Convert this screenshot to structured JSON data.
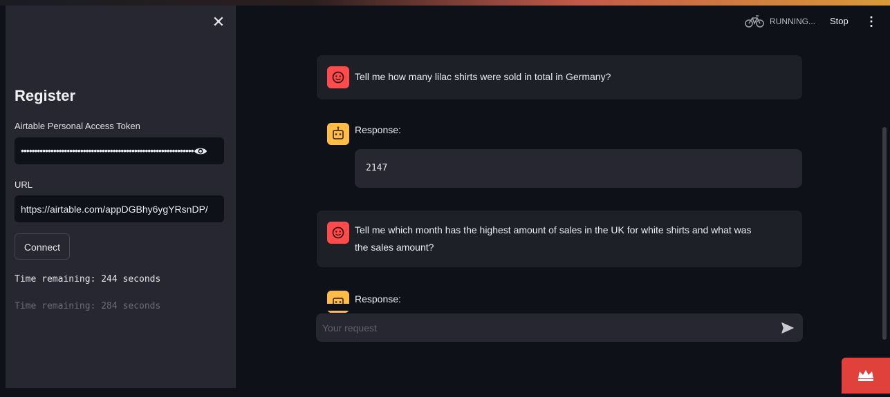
{
  "sidebar": {
    "close_label": "✕",
    "title": "Register",
    "token_label": "Airtable Personal Access Token",
    "token_masked": "••••••••••••••••••••••••••••••••••••••••••••••••••••••••••••••••",
    "url_label": "URL",
    "url_value": "https://airtable.com/appDGBhy6ygYRsnDP/",
    "connect_label": "Connect",
    "timer_current": "Time remaining: 244 seconds",
    "timer_previous": "Time remaining: 284 seconds"
  },
  "toolbar": {
    "status": "RUNNING...",
    "stop_label": "Stop",
    "menu_label": "⋮"
  },
  "chat": {
    "messages": [
      {
        "role": "user",
        "text": "Tell me how many lilac shirts were sold in total in Germany?"
      },
      {
        "role": "assistant",
        "label": "Response:",
        "value": "2147"
      },
      {
        "role": "user",
        "text_line1": "Tell me which month has the highest amount of sales in the UK for white shirts and what was",
        "text_line2": "the sales amount?"
      },
      {
        "role": "assistant",
        "label": "Response:"
      }
    ],
    "input_placeholder": "Your request"
  },
  "colors": {
    "user_avatar": "#ff4b4b",
    "assistant_avatar": "#ffbd45",
    "accent_red": "#e0413a"
  },
  "icons": [
    "close-icon",
    "eye-icon",
    "bicycle-icon",
    "kebab-menu-icon",
    "user-avatar-icon",
    "bot-avatar-icon",
    "send-icon",
    "crown-icon"
  ]
}
